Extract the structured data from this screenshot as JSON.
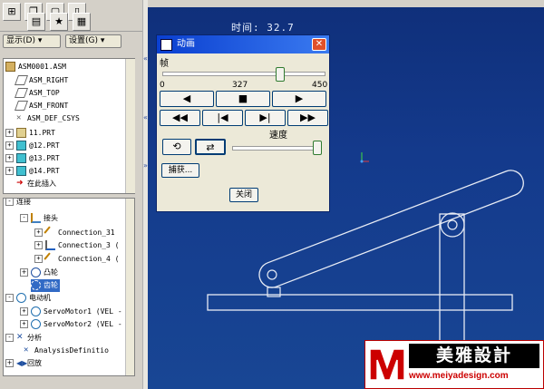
{
  "left_panel": {
    "dropdowns": {
      "display": "显示(D) ▾",
      "settings": "设置(G) ▾"
    },
    "model_tree": [
      {
        "label": "ASM0001.ASM"
      },
      {
        "label": "ASM_RIGHT"
      },
      {
        "label": "ASM_TOP"
      },
      {
        "label": "ASM_FRONT"
      },
      {
        "label": "ASM_DEF_CSYS"
      },
      {
        "label": "11.PRT"
      },
      {
        "label": "@12.PRT"
      },
      {
        "label": "@13.PRT"
      },
      {
        "label": "@14.PRT"
      },
      {
        "label": "在此插入"
      }
    ],
    "mech_tree": [
      {
        "label": "连接"
      },
      {
        "label": "接头"
      },
      {
        "label": "Connection_31"
      },
      {
        "label": "Connection_3 ("
      },
      {
        "label": "Connection_4 ("
      },
      {
        "label": "凸轮"
      },
      {
        "label": "齿轮"
      },
      {
        "label": "电动机"
      },
      {
        "label": "ServoMotor1 (VEL -"
      },
      {
        "label": "ServoMotor2 (VEL -"
      },
      {
        "label": "分析"
      },
      {
        "label": "AnalysisDefinitio"
      },
      {
        "label": "回放"
      }
    ]
  },
  "viewport": {
    "time_label": "时间: 32.7"
  },
  "dialog": {
    "title": "动画",
    "frame_label": "帧",
    "frame_min": "0",
    "frame_current": "327",
    "frame_max": "450",
    "frame_fraction": 0.727,
    "speed_label": "速度",
    "speed_fraction": 1.0,
    "capture_label": "捕获...",
    "close_label": "关闭",
    "close_x": "✕"
  },
  "logo": {
    "brand": "美雅設計",
    "url": "www.meiyadesign.com"
  },
  "colors": {
    "viewport_bg": "#143a8c",
    "dialog_title": "#0a3fd0",
    "logo_red": "#cc0000"
  }
}
